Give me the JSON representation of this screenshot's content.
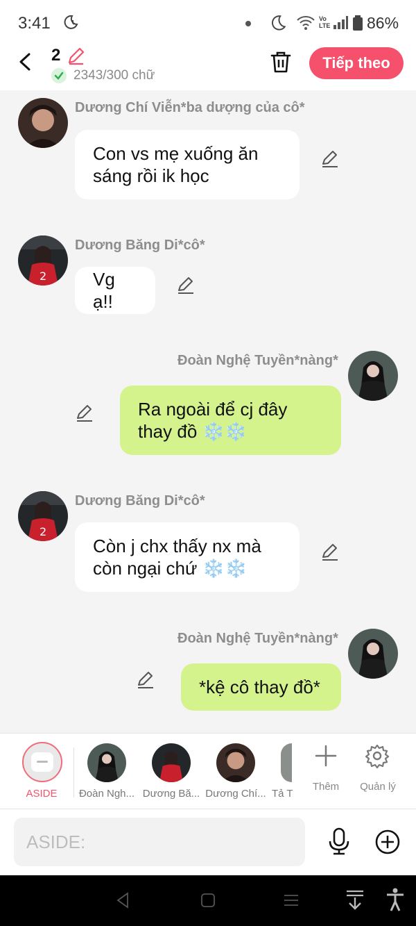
{
  "status_bar": {
    "time": "3:41",
    "network_label": "Vo\nLTE",
    "battery": "86%",
    "icons": [
      "moon-clock-icon",
      "notification-dot",
      "do-not-disturb-moon-icon",
      "wifi-icon",
      "signal-icon",
      "battery-icon"
    ]
  },
  "header": {
    "chapter_number": "2",
    "word_count": "2343/300 chữ",
    "next_button": "Tiếp theo"
  },
  "messages": [
    {
      "side": "left",
      "sender": "Dương Chí Viễn*ba dượng của cô*",
      "text": "Con vs mẹ xuống ăn sáng rồi ik học",
      "avatar": "man-avatar"
    },
    {
      "side": "left",
      "sender": "Dương Băng Di*cô*",
      "text": "Vg ạ!!",
      "avatar": "girl-red-jacket-avatar"
    },
    {
      "side": "right",
      "sender": "Đoàn Nghệ Tuyền*nàng*",
      "text": "Ra ngoài để cj đây thay đồ ❄️❄️",
      "avatar": "girl-dark-avatar"
    },
    {
      "side": "left",
      "sender": "Dương Băng Di*cô*",
      "text": "Còn j chx thấy nx mà còn ngại chứ ❄️❄️",
      "avatar": "girl-red-jacket-avatar"
    },
    {
      "side": "right",
      "sender": "Đoàn Nghệ Tuyền*nàng*",
      "text": "*kệ cô thay đồ*",
      "avatar": "girl-dark-avatar"
    }
  ],
  "character_bar": {
    "aside_label": "ASIDE",
    "characters": [
      "Đoàn Ngh...",
      "Dương Bă...",
      "Dương Chí...",
      "Tả T"
    ],
    "add_label": "Thêm",
    "manage_label": "Quản lý"
  },
  "input": {
    "placeholder": "ASIDE:"
  },
  "colors": {
    "accent": "#f5516c",
    "bubble_left": "#ffffff",
    "bubble_right": "#d5f38c",
    "background": "#f4f4f4"
  }
}
